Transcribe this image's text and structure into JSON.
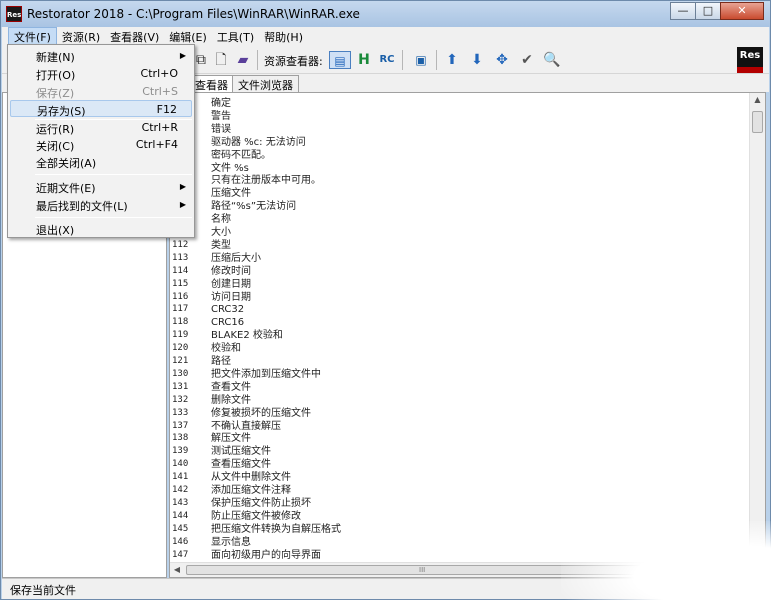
{
  "window": {
    "title": "Restorator 2018 - C:\\Program Files\\WinRAR\\WinRAR.exe",
    "app_icon": "Res",
    "minimize": "—",
    "maximize": "□",
    "close": "✕"
  },
  "menubar": [
    "文件(F)",
    "资源(R)",
    "查看器(V)",
    "编辑(E)",
    "工具(T)",
    "帮助(H)"
  ],
  "toolbar": {
    "viewer_label": "资源查看器:",
    "logo": "Res",
    "icons": [
      "copy-icon",
      "page-icon",
      "book-icon",
      "viewer-window-icon",
      "hex-h-icon",
      "rc-icon",
      "dialog-icon",
      "arrow-up-icon",
      "arrow-down-icon",
      "move-icon",
      "check-icon",
      "find-icon"
    ]
  },
  "tabs": [
    "查看器",
    "文件浏览器"
  ],
  "file_menu": {
    "items": [
      {
        "label": "新建(N)",
        "submenu": true
      },
      {
        "label": "打开(O)",
        "shortcut": "Ctrl+O"
      },
      {
        "label": "保存(Z)",
        "shortcut": "Ctrl+S",
        "disabled": true
      },
      {
        "label": "另存为(S)",
        "shortcut": "F12",
        "highlighted": true
      },
      {
        "label": "运行(R)",
        "shortcut": "Ctrl+R"
      },
      {
        "label": "关闭(C)",
        "shortcut": "Ctrl+F4"
      },
      {
        "label": "全部关闭(A)"
      },
      {
        "label": "近期文件(E)",
        "submenu": true
      },
      {
        "label": "最后找到的文件(L)",
        "submenu": true
      },
      {
        "label": "退出(X)"
      }
    ]
  },
  "string_rows": [
    {
      "id": "",
      "text": "确定"
    },
    {
      "id": "",
      "text": "警告"
    },
    {
      "id": "",
      "text": "错误"
    },
    {
      "id": "",
      "text": "驱动器 %c: 无法访问"
    },
    {
      "id": "",
      "text": "密码不匹配。"
    },
    {
      "id": "",
      "text": "文件 %s"
    },
    {
      "id": "",
      "text": "只有在注册版本中可用。"
    },
    {
      "id": "",
      "text": "压缩文件"
    },
    {
      "id": "",
      "text": "路径“%s”无法访问"
    },
    {
      "id": "",
      "text": "名称"
    },
    {
      "id": "",
      "text": "大小"
    },
    {
      "id": "112",
      "text": "类型"
    },
    {
      "id": "113",
      "text": "压缩后大小"
    },
    {
      "id": "114",
      "text": "修改时间"
    },
    {
      "id": "115",
      "text": "创建日期"
    },
    {
      "id": "116",
      "text": "访问日期"
    },
    {
      "id": "117",
      "text": "CRC32"
    },
    {
      "id": "118",
      "text": "CRC16"
    },
    {
      "id": "119",
      "text": "BLAKE2 校验和"
    },
    {
      "id": "120",
      "text": "校验和"
    },
    {
      "id": "121",
      "text": "路径"
    },
    {
      "id": "130",
      "text": "把文件添加到压缩文件中"
    },
    {
      "id": "131",
      "text": "查看文件"
    },
    {
      "id": "132",
      "text": "删除文件"
    },
    {
      "id": "133",
      "text": "修复被损坏的压缩文件"
    },
    {
      "id": "137",
      "text": "不确认直接解压"
    },
    {
      "id": "138",
      "text": "解压文件"
    },
    {
      "id": "139",
      "text": "测试压缩文件"
    },
    {
      "id": "140",
      "text": "查看压缩文件"
    },
    {
      "id": "141",
      "text": "从文件中删除文件"
    },
    {
      "id": "142",
      "text": "添加压缩文件注释"
    },
    {
      "id": "143",
      "text": "保护压缩文件防止损坏"
    },
    {
      "id": "144",
      "text": "防止压缩文件被修改"
    },
    {
      "id": "145",
      "text": "把压缩文件转换为自解压格式"
    },
    {
      "id": "146",
      "text": "显示信息"
    },
    {
      "id": "147",
      "text": "面向初级用户的向导界面"
    }
  ],
  "hscroll_grip": "III",
  "status": "保存当前文件"
}
